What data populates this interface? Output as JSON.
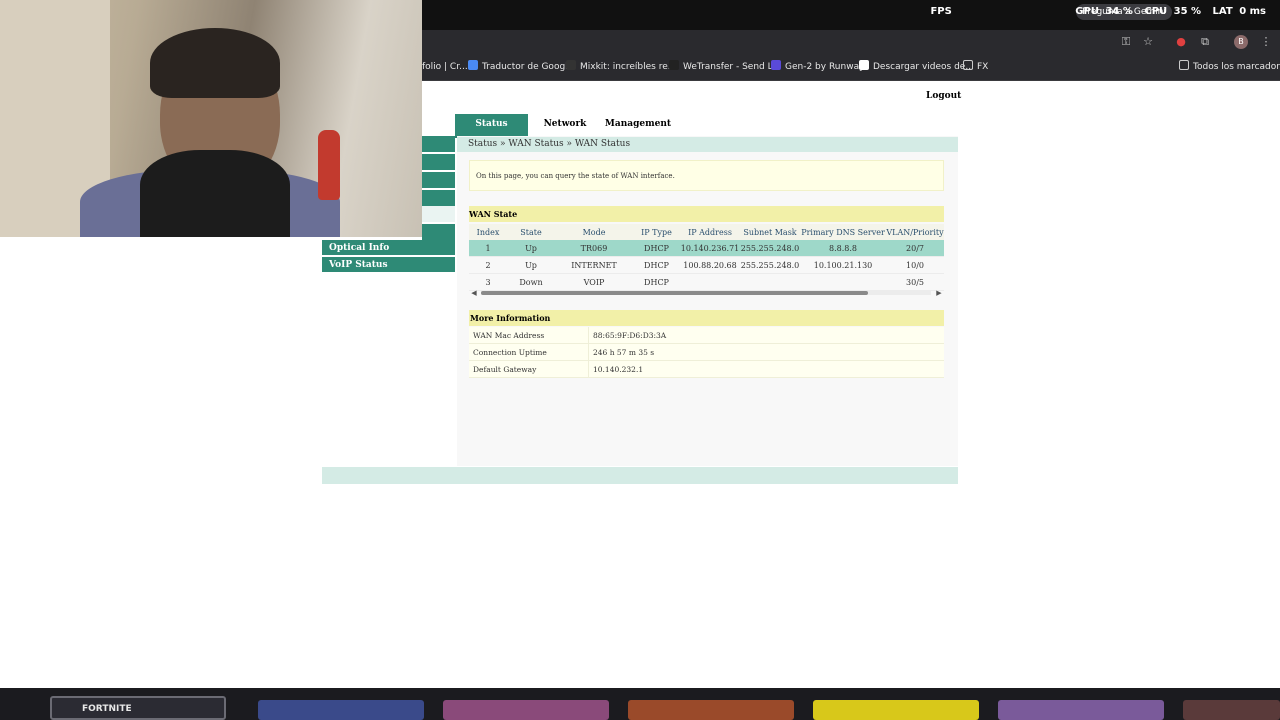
{
  "browser": {
    "bookmarks": [
      {
        "label": "folio | Cr...",
        "icon": "page-icon"
      },
      {
        "label": "Traductor de Google",
        "icon": "translate-icon"
      },
      {
        "label": "Mixkit: increíbles re...",
        "icon": "mixkit-icon"
      },
      {
        "label": "WeTransfer - Send L...",
        "icon": "wetransfer-icon"
      },
      {
        "label": "Gen-2 by Runway",
        "icon": "runway-icon"
      },
      {
        "label": "Descargar videos de...",
        "icon": "download-icon"
      },
      {
        "label": "FX",
        "icon": "folder-icon"
      },
      {
        "label": "Todos los marcadores",
        "icon": "folder-icon"
      }
    ],
    "gemini_chip": "Pregunta a Gemini",
    "overlay": {
      "fps_label": "FPS",
      "gpu_label": "GPU",
      "gpu_value": "34 %",
      "cpu_label": "CPU",
      "cpu_value": "35 %",
      "lat_label": "LAT",
      "lat_value": "0 ms"
    },
    "avatar_letter": "B"
  },
  "router": {
    "logout": "Logout",
    "tabs": [
      {
        "label": "Status",
        "active": true
      },
      {
        "label": "Network",
        "active": false
      },
      {
        "label": "Management",
        "active": false
      }
    ],
    "side_menu": [
      {
        "label": "Optical Info"
      },
      {
        "label": "VoIP Status"
      }
    ],
    "breadcrumb": "Status » WAN Status » WAN Status",
    "info_text": "On this page, you can query the state of WAN interface.",
    "wan_state": {
      "title": "WAN State",
      "columns": [
        "Index",
        "State",
        "Mode",
        "IP Type",
        "IP Address",
        "Subnet Mask",
        "Primary DNS Server",
        "VLAN/Priority"
      ],
      "rows": [
        [
          "1",
          "Up",
          "TR069",
          "DHCP",
          "10.140.236.71",
          "255.255.248.0",
          "8.8.8.8",
          "20/7"
        ],
        [
          "2",
          "Up",
          "INTERNET",
          "DHCP",
          "100.88.20.68",
          "255.255.248.0",
          "10.100.21.130",
          "10/0"
        ],
        [
          "3",
          "Down",
          "VOIP",
          "DHCP",
          "",
          "",
          "",
          "30/5"
        ]
      ],
      "selected_row": 0,
      "scroll_fraction": 0.86
    },
    "more_info": {
      "title": "More Information",
      "rows": [
        {
          "key": "WAN Mac Address",
          "value": "88:65:9F:D6:D3:3A"
        },
        {
          "key": "Connection Uptime",
          "value": "246 h 57 m 35 s"
        },
        {
          "key": "Default Gateway",
          "value": "10.140.232.1"
        }
      ]
    }
  },
  "taskbar": {
    "fortnite_label": "FORTNITE"
  },
  "colors": {
    "accent": "#2e8a76",
    "breadcrumb_bg": "#d4ebe5",
    "section_bg": "#f2f0a8",
    "selected_row": "#9ed8c9"
  }
}
